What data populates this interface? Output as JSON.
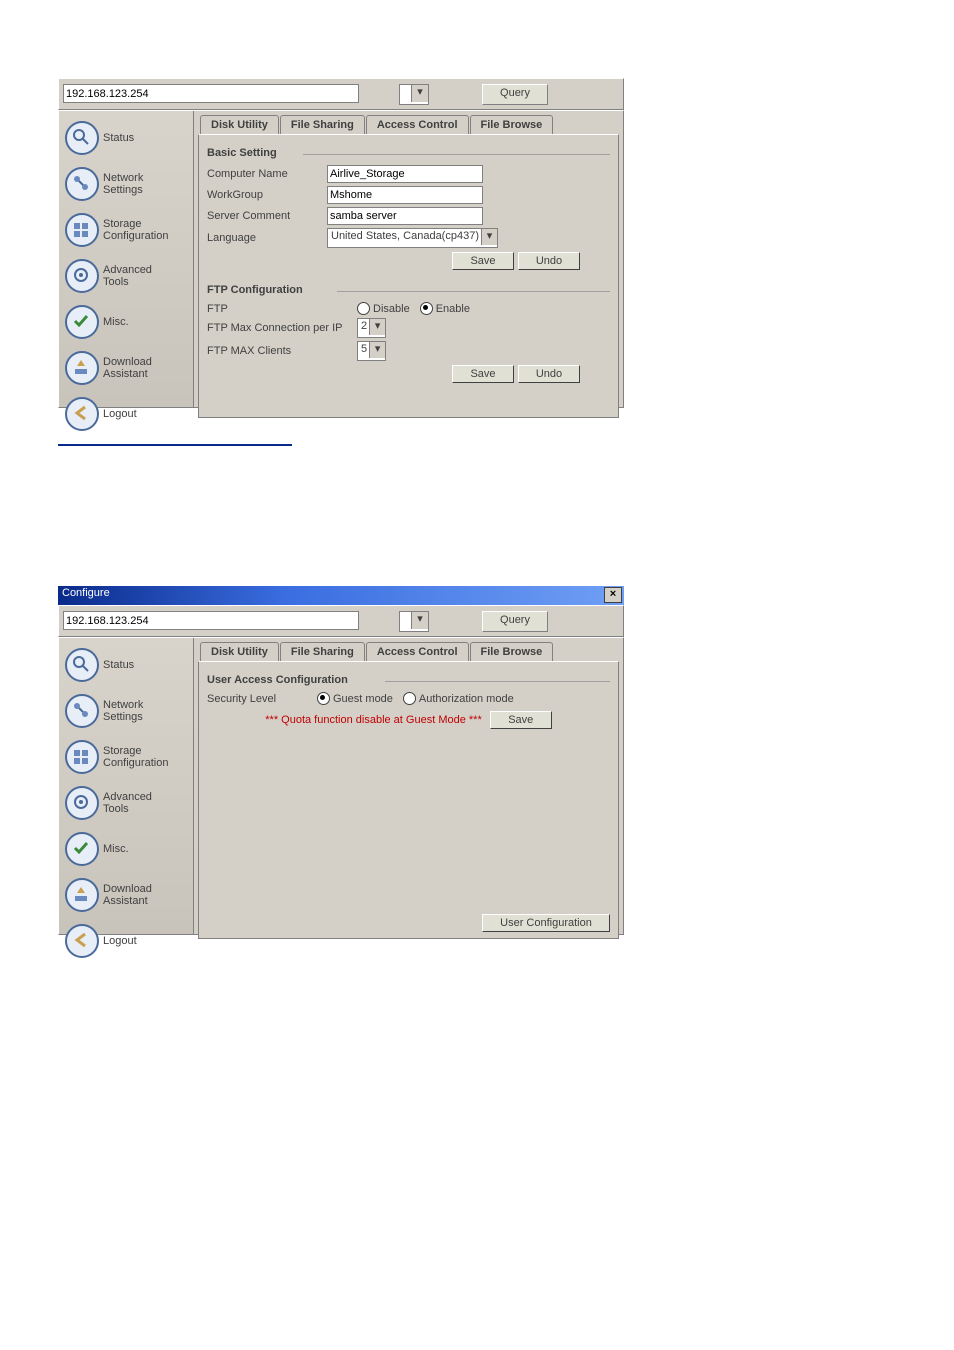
{
  "address": "192.168.123.254",
  "query_btn": "Query",
  "tabs": {
    "disk": "Disk Utility",
    "share": "File Sharing",
    "access": "Access Control",
    "browse": "File Browse"
  },
  "sidebar": [
    {
      "label": "Status"
    },
    {
      "label": "Network\nSettings"
    },
    {
      "label": "Storage\nConfiguration"
    },
    {
      "label": "Advanced\nTools"
    },
    {
      "label": "Misc."
    },
    {
      "label": "Download\nAssistant"
    },
    {
      "label": "Logout"
    }
  ],
  "s1": {
    "active_tab": "share",
    "basic_title": "Basic Setting",
    "computer_name_lbl": "Computer Name",
    "computer_name": "Airlive_Storage",
    "workgroup_lbl": "WorkGroup",
    "workgroup": "Mshome",
    "server_comment_lbl": "Server Comment",
    "server_comment": "samba server",
    "language_lbl": "Language",
    "language": "United States, Canada(cp437)",
    "ftp_title": "FTP Configuration",
    "ftp_lbl": "FTP",
    "disable": "Disable",
    "enable": "Enable",
    "ftp_enabled": true,
    "maxperip_lbl": "FTP Max Connection per IP",
    "maxperip": "2",
    "maxclients_lbl": "FTP MAX Clients",
    "maxclients": "5",
    "save": "Save",
    "undo": "Undo"
  },
  "s2": {
    "title": "Configure",
    "active_tab": "access",
    "uac_title": "User Access Configuration",
    "sec_lbl": "Security Level",
    "guest": "Guest mode",
    "auth": "Authorization mode",
    "guest_on": true,
    "quota_msg": "*** Quota function disable at Guest Mode ***",
    "save": "Save",
    "user_cfg": "User Configuration"
  }
}
